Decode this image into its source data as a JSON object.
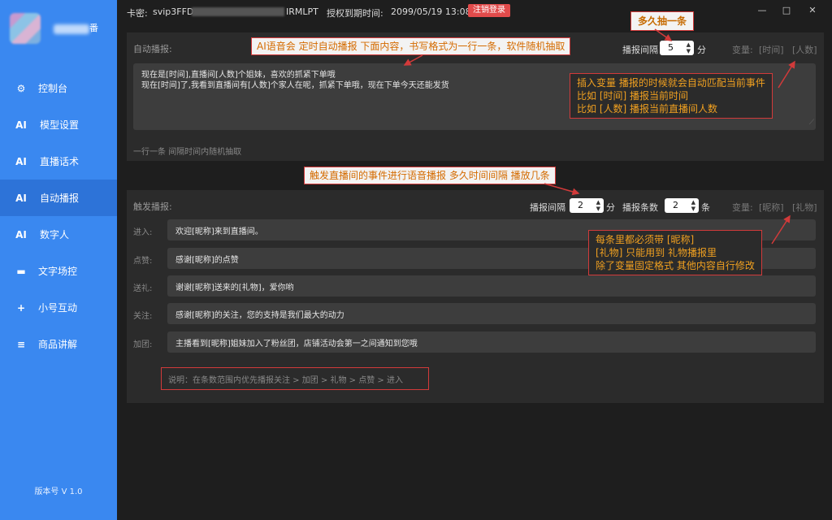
{
  "sidebar": {
    "username_tail": "番",
    "items": [
      {
        "icon": "⚙",
        "label": "控制台",
        "active": false
      },
      {
        "icon": "AI",
        "label": "模型设置",
        "active": false
      },
      {
        "icon": "AI",
        "label": "直播话术",
        "active": false
      },
      {
        "icon": "AI",
        "label": "自动播报",
        "active": true
      },
      {
        "icon": "AI",
        "label": "数字人",
        "active": false
      },
      {
        "icon": "▬",
        "label": "文字场控",
        "active": false
      },
      {
        "icon": "+",
        "label": "小号互动",
        "active": false
      },
      {
        "icon": "≡",
        "label": "商品讲解",
        "active": false
      }
    ],
    "version": "版本号 V 1.0"
  },
  "topbar": {
    "card_label": "卡密:",
    "card_value_start": "svip3FFD",
    "card_value_end": "IRMLPT",
    "expire_label": "授权到期时间:",
    "expire_value": "2099/05/19 13:08",
    "logout_label": "注销登录",
    "minimize": "—",
    "maximize": "□",
    "close": "✕"
  },
  "auto_panel": {
    "title": "自动播报:",
    "interval_label": "播报间隔",
    "interval_value": "5",
    "interval_unit": "分",
    "var_label": "变量:",
    "var_time": "[时间]",
    "var_people": "[人数]",
    "content_lines": [
      "现在是[时间],直播间[人数]个姐妹，喜欢的抓紧下单哦",
      "现在[时间]了,我看到直播间有[人数]个家人在呢，抓紧下单哦，现在下单今天还能发货"
    ],
    "hint": "一行一条 间隔时间内随机抽取"
  },
  "trigger_panel": {
    "title": "触发播报:",
    "interval_label": "播报间隔",
    "interval_value": "2",
    "interval_unit": "分",
    "count_label": "播报条数",
    "count_value": "2",
    "count_unit": "条",
    "var_label": "变量:",
    "var_nick": "[昵称]",
    "var_gift": "[礼物]",
    "rows": [
      {
        "label": "进入:",
        "value": "欢迎[昵称]来到直播间。"
      },
      {
        "label": "点赞:",
        "value": "感谢[昵称]的点赞"
      },
      {
        "label": "送礼:",
        "value": "谢谢[昵称]送来的[礼物]，爱你哟"
      },
      {
        "label": "关注:",
        "value": "感谢[昵称]的关注，您的支持是我们最大的动力"
      },
      {
        "label": "加团:",
        "value": "主播看到[昵称]姐妹加入了粉丝团，店铺活动会第一之间通知到您哦"
      }
    ],
    "note": "说明：在条数范围内优先播报关注 > 加团 > 礼物 > 点赞 > 进入"
  },
  "annotations": {
    "freq": "多久抽一条",
    "auto_desc": "AI语音会 定时自动播报 下面内容，书写格式为一行一条，软件随机抽取",
    "var_lines": [
      "插入变量  播报的时候就会自动匹配当前事件",
      "比如 [时间] 播报当前时间",
      "比如 [人数] 播报当前直播间人数"
    ],
    "trigger_desc": "触发直播间的事件进行语音播报  多久时间间隔 播放几条",
    "rule_lines": [
      "每条里都必须带 [昵称]",
      "[礼物] 只能用到 礼物播报里",
      "除了变量固定格式 其他内容自行修改"
    ]
  },
  "colors": {
    "sidebar": "#3a88f0",
    "sidebar_active": "#2d73d8",
    "background": "#1e1e1e",
    "panel": "#2b2b2b",
    "input": "#3d3d3d",
    "logout": "#e14b4b",
    "annotation_border": "#d23a3a",
    "annotation_text": "#f0a020"
  }
}
